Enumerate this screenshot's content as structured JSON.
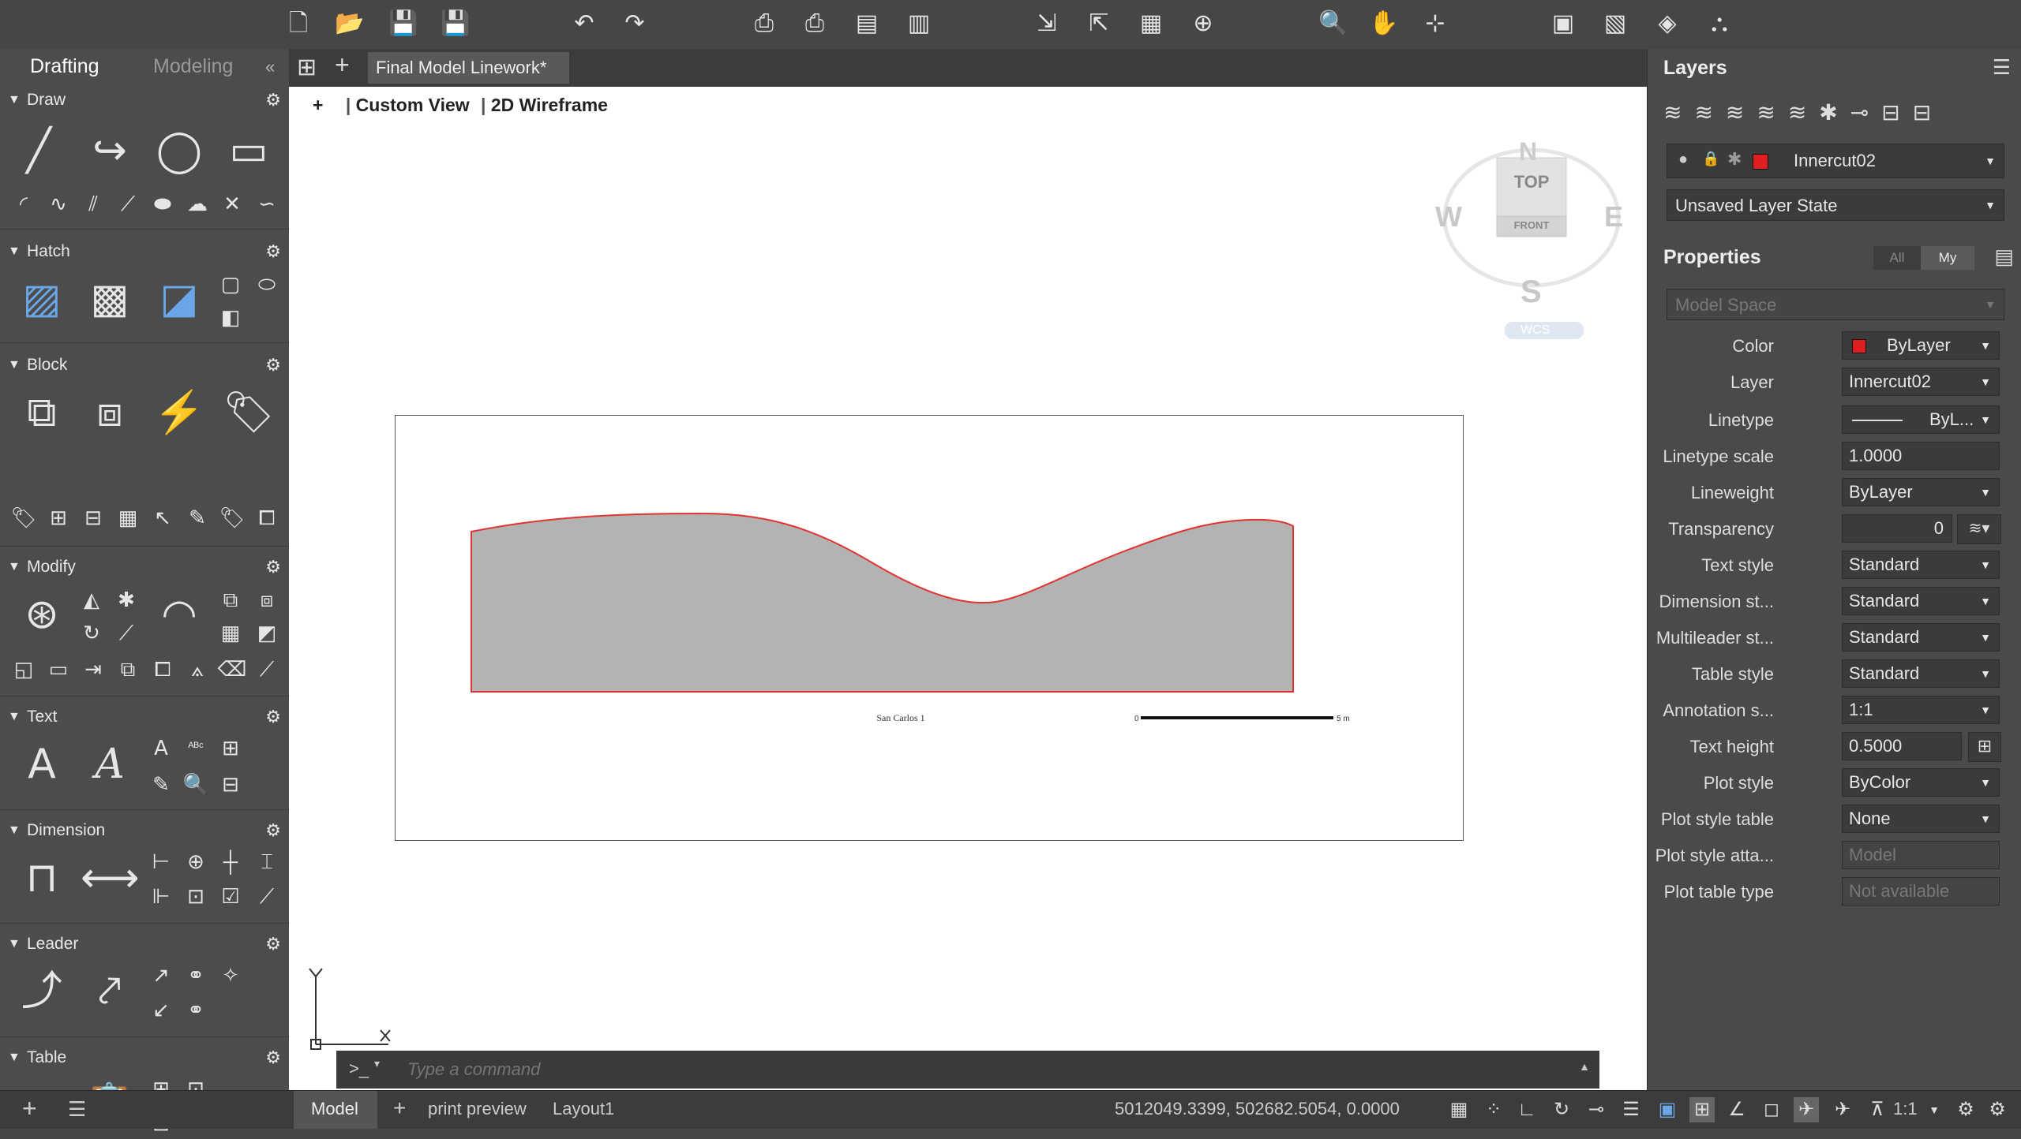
{
  "toolbar": {
    "icons": [
      "new-icon",
      "open-icon",
      "save-icon",
      "save-as-icon",
      "undo-icon",
      "redo-icon",
      "plot-icon",
      "batch-plot-icon",
      "publish-icon",
      "page-setup-icon",
      "import-icon",
      "export-icon",
      "sheet-icon",
      "share-icon",
      "zoom-icon",
      "pan-icon",
      "orbit-icon",
      "layer-icon",
      "xref-icon",
      "render-icon",
      "tree-icon"
    ]
  },
  "palette": {
    "tabs": {
      "drafting": "Drafting",
      "modeling": "Modeling",
      "collapse": "«"
    },
    "sections": {
      "draw": "Draw",
      "hatch": "Hatch",
      "block": "Block",
      "modify": "Modify",
      "text": "Text",
      "dimension": "Dimension",
      "leader": "Leader",
      "table": "Table"
    },
    "text_glyph": "A"
  },
  "document": {
    "tab_label": "Final Model Linework*",
    "view_plus": "+",
    "view_name": "Custom View",
    "visual_style": "2D Wireframe",
    "drawing_title": "San Carlos 1",
    "scale_start": "0",
    "scale_end": "5 m"
  },
  "viewcube": {
    "top": "TOP",
    "front": "FRONT",
    "north": "N",
    "south": "S",
    "east": "E",
    "west": "W",
    "ucs": "WCS"
  },
  "command": {
    "prompt": ">_",
    "placeholder": "Type a command"
  },
  "layers": {
    "title": "Layers",
    "current_layer": "Innercut02",
    "layer_state": "Unsaved Layer State",
    "layer_color": "#e02020"
  },
  "properties": {
    "title": "Properties",
    "filter_all": "All",
    "filter_my": "My",
    "space": "Model Space",
    "rows": [
      {
        "label": "Color",
        "value": "ByLayer"
      },
      {
        "label": "Layer",
        "value": "Innercut02"
      },
      {
        "label": "Linetype",
        "value": "ByL..."
      },
      {
        "label": "Linetype scale",
        "value": "1.0000"
      },
      {
        "label": "Lineweight",
        "value": "ByLayer"
      },
      {
        "label": "Transparency",
        "value": "0"
      },
      {
        "label": "Text style",
        "value": "Standard"
      },
      {
        "label": "Dimension st...",
        "value": "Standard"
      },
      {
        "label": "Multileader st...",
        "value": "Standard"
      },
      {
        "label": "Table style",
        "value": "Standard"
      },
      {
        "label": "Annotation s...",
        "value": "1:1"
      },
      {
        "label": "Text height",
        "value": "0.5000"
      },
      {
        "label": "Plot style",
        "value": "ByColor"
      },
      {
        "label": "Plot style table",
        "value": "None"
      },
      {
        "label": "Plot style atta...",
        "value": "Model"
      },
      {
        "label": "Plot table type",
        "value": "Not available"
      }
    ]
  },
  "status": {
    "tabs": {
      "model": "Model",
      "add": "+",
      "print_preview": "print preview",
      "layout1": "Layout1"
    },
    "coords": "5012049.3399, 502682.5054, 0.0000",
    "scale": "1:1"
  }
}
